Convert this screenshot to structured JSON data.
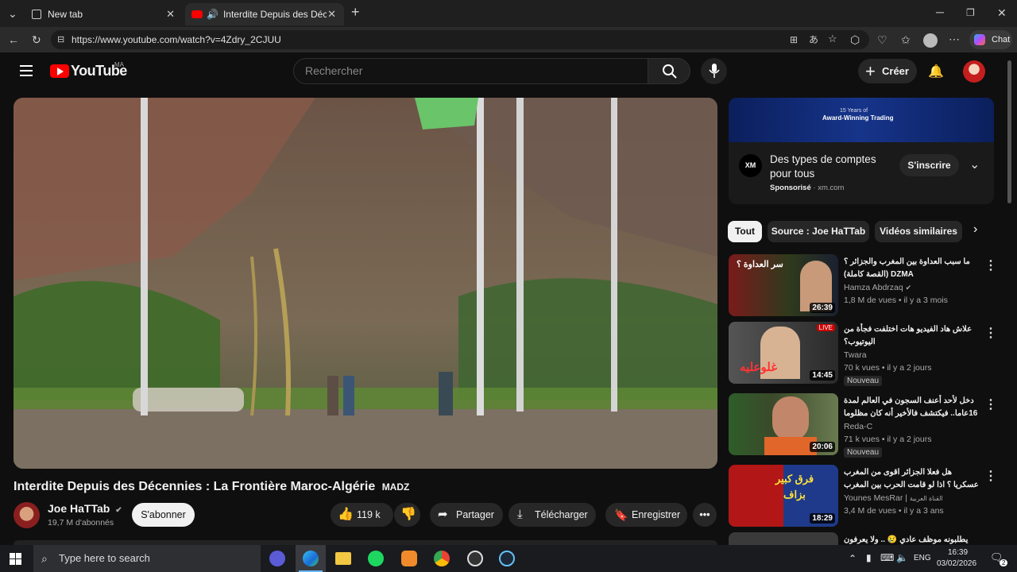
{
  "browser": {
    "tabs": [
      {
        "label": "New tab",
        "icon": "page-icon"
      },
      {
        "label": "Interdite Depuis des Décennies",
        "icon": "youtube-icon",
        "audio": "speaker-icon"
      }
    ],
    "url": "https://www.youtube.com/watch?v=4Zdry_2CJUU",
    "chat_label": "Chat"
  },
  "youtube": {
    "logo_text": "YouTube",
    "region": "MA",
    "search_placeholder": "Rechercher",
    "create_label": "Créer",
    "video": {
      "title": "Interdite Depuis des Décennies : La Frontière Maroc-Algérie",
      "title_suffix": "MADZ",
      "channel": "Joe HaTTab",
      "subscribers": "19,7 M d'abonnés",
      "subscribe_label": "S'abonner",
      "likes": "119 k",
      "share_label": "Partager",
      "download_label": "Télécharger",
      "save_label": "Enregistrer"
    },
    "ad": {
      "banner_line1": "15 Years of",
      "banner_line2": "Award-Winning Trading",
      "logo": "XM",
      "title": "Des types de comptes pour tous",
      "sponsored": "Sponsorisé",
      "domain": "xm.com",
      "cta": "S'inscrire"
    },
    "chips": [
      "Tout",
      "Source : Joe HaTTab",
      "Vidéos similaires"
    ],
    "recommendations": [
      {
        "title": "ما سبب العداوة بين المغرب والجزائر ؟ DZMA (القصة كاملة)",
        "channel": "Hamza Abdrzaq",
        "meta": "1,8 M de vues • il y a 3 mois",
        "duration": "26:39",
        "badge": "",
        "thumb_text": "سر العداوة ؟",
        "colors": [
          "#7a1b1b",
          "#2f3a1c"
        ]
      },
      {
        "title": "علاش هاد الفيديو هات اختلفت فجأة من اليوتيوب؟",
        "channel": "Twara",
        "meta": "70 k vues • il y a 2 jours",
        "duration": "14:45",
        "badge": "Nouveau",
        "thumb_text": "غلوعليه",
        "live": "LIVE",
        "colors": [
          "#c44",
          "#333"
        ]
      },
      {
        "title": "دخل لأحد أعنف السجون في العالم لمدة 16عاما.. فيكتشف فالأخير  أنه كان مظلوما",
        "channel": "Reda-C",
        "meta": "71 k vues • il y a 2 jours",
        "duration": "20:06",
        "badge": "Nouveau",
        "colors": [
          "#2f5d2a",
          "#c0602a"
        ]
      },
      {
        "title": "هل فعلا الجزائر اقوى من المغرب عسكريا ؟ اذا لو قامت الحرب بين المغرب و الجزائر؟",
        "channel": "Younes MesRar",
        "channel_suffix": "القناة العربية",
        "meta": "3,4 M de vues • il y a 3 ans",
        "duration": "18:29",
        "badge": "",
        "thumb_text": "فرق كبير بزاف",
        "colors": [
          "#b31616",
          "#1f3a8a"
        ]
      },
      {
        "title": "يطلبونه موظف عادي 😢 .. ولا يعرفون أنه",
        "channel": "",
        "meta": "",
        "duration": "",
        "badge": "",
        "colors": [
          "#444",
          "#222"
        ]
      }
    ]
  },
  "taskbar": {
    "search_placeholder": "Type here to search",
    "language": "ENG",
    "time": "16:39",
    "date": "03/02/2026",
    "notification_count": "2"
  }
}
